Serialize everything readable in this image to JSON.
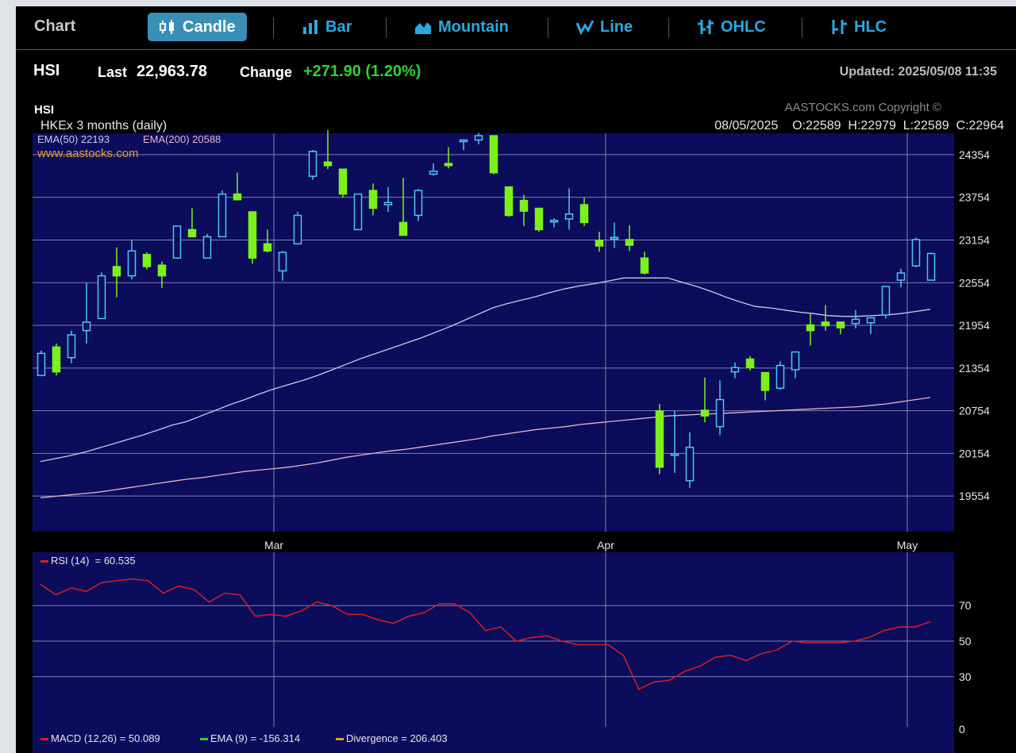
{
  "toolbar": {
    "label": "Chart",
    "buttons": [
      {
        "label": "Candle",
        "icon": "candle-icon",
        "active": true
      },
      {
        "label": "Bar",
        "icon": "bar-icon",
        "active": false
      },
      {
        "label": "Mountain",
        "icon": "mountain-icon",
        "active": false
      },
      {
        "label": "Line",
        "icon": "line-icon",
        "active": false
      },
      {
        "label": "OHLC",
        "icon": "ohlc-icon",
        "active": false
      },
      {
        "label": "HLC",
        "icon": "hlc-icon",
        "active": false
      }
    ]
  },
  "quote": {
    "symbol": "HSI",
    "last_label": "Last",
    "last_value": "22,963.78",
    "change_label": "Change",
    "change_value": "+271.90 (1.20%)",
    "updated": "Updated: 2025/05/08 11:35"
  },
  "colors": {
    "plot_bg": "#0c0c5c",
    "up_candle": "#4fc3f7",
    "down_candle": "#7cf01a",
    "ema50": "#c9c9ec",
    "ema200": "#e2b4c8",
    "rsi": "#d81e1e",
    "change": "#2fd12f"
  },
  "chart_header": {
    "title": "HSI",
    "subtitle": "HKEx  3 months (daily)",
    "copyright": "AASTOCKS.com Copyright ©",
    "ohlc_readout": "08/05/2025    O:22589  H:22979  L:22589  C:22964",
    "ema50_label": "EMA(50) 22193",
    "ema200_label": "EMA(200) 20588",
    "website": "www.aastocks.com"
  },
  "chart_data": [
    {
      "type": "candlestick",
      "title": "HSI",
      "ylim": [
        19054,
        24654
      ],
      "yticks": [
        19554,
        20154,
        20754,
        21354,
        21954,
        22554,
        23154,
        23754,
        24354
      ],
      "xticks": [
        {
          "label": "Mar",
          "index": 15
        },
        {
          "label": "Apr",
          "index": 37
        },
        {
          "label": "May",
          "index": 57
        }
      ],
      "last_index": 60,
      "candles": [
        {
          "o": 21250,
          "h": 21600,
          "l": 21250,
          "c": 21560
        },
        {
          "o": 21650,
          "h": 21700,
          "l": 21250,
          "c": 21300
        },
        {
          "o": 21500,
          "h": 21880,
          "l": 21420,
          "c": 21820
        },
        {
          "o": 21880,
          "h": 22550,
          "l": 21700,
          "c": 22000
        },
        {
          "o": 22050,
          "h": 22700,
          "l": 22050,
          "c": 22650
        },
        {
          "o": 22780,
          "h": 23050,
          "l": 22350,
          "c": 22650
        },
        {
          "o": 22650,
          "h": 23150,
          "l": 22600,
          "c": 23000
        },
        {
          "o": 22950,
          "h": 22980,
          "l": 22740,
          "c": 22780
        },
        {
          "o": 22800,
          "h": 22850,
          "l": 22480,
          "c": 22650
        },
        {
          "o": 22900,
          "h": 23350,
          "l": 22900,
          "c": 23350
        },
        {
          "o": 23300,
          "h": 23600,
          "l": 23200,
          "c": 23200
        },
        {
          "o": 22900,
          "h": 23240,
          "l": 22900,
          "c": 23200
        },
        {
          "o": 23200,
          "h": 23850,
          "l": 23200,
          "c": 23800
        },
        {
          "o": 23800,
          "h": 24100,
          "l": 23720,
          "c": 23720
        },
        {
          "o": 23550,
          "h": 23550,
          "l": 22820,
          "c": 22900
        },
        {
          "o": 23100,
          "h": 23300,
          "l": 22980,
          "c": 23000
        },
        {
          "o": 22720,
          "h": 23000,
          "l": 22580,
          "c": 22980
        },
        {
          "o": 23100,
          "h": 23550,
          "l": 23100,
          "c": 23500
        },
        {
          "o": 24050,
          "h": 24420,
          "l": 24000,
          "c": 24400
        },
        {
          "o": 24250,
          "h": 24700,
          "l": 24150,
          "c": 24200
        },
        {
          "o": 24150,
          "h": 24150,
          "l": 23750,
          "c": 23800
        },
        {
          "o": 23300,
          "h": 23800,
          "l": 23300,
          "c": 23800
        },
        {
          "o": 23850,
          "h": 23950,
          "l": 23500,
          "c": 23600
        },
        {
          "o": 23650,
          "h": 23900,
          "l": 23550,
          "c": 23680
        },
        {
          "o": 23400,
          "h": 24030,
          "l": 23230,
          "c": 23220
        },
        {
          "o": 23500,
          "h": 23870,
          "l": 23420,
          "c": 23850
        },
        {
          "o": 24080,
          "h": 24230,
          "l": 24060,
          "c": 24120
        },
        {
          "o": 24230,
          "h": 24460,
          "l": 24160,
          "c": 24200
        },
        {
          "o": 24550,
          "h": 24560,
          "l": 24420,
          "c": 24560
        },
        {
          "o": 24560,
          "h": 24660,
          "l": 24500,
          "c": 24620
        },
        {
          "o": 24620,
          "h": 24620,
          "l": 24080,
          "c": 24100
        },
        {
          "o": 23900,
          "h": 23900,
          "l": 23480,
          "c": 23500
        },
        {
          "o": 23710,
          "h": 23790,
          "l": 23350,
          "c": 23560
        },
        {
          "o": 23600,
          "h": 23600,
          "l": 23270,
          "c": 23300
        },
        {
          "o": 23410,
          "h": 23460,
          "l": 23330,
          "c": 23430
        },
        {
          "o": 23450,
          "h": 23880,
          "l": 23300,
          "c": 23520
        },
        {
          "o": 23650,
          "h": 23750,
          "l": 23350,
          "c": 23400
        },
        {
          "o": 23150,
          "h": 23270,
          "l": 22990,
          "c": 23070
        },
        {
          "o": 23190,
          "h": 23400,
          "l": 23040,
          "c": 23190
        },
        {
          "o": 23160,
          "h": 23360,
          "l": 23000,
          "c": 23080
        },
        {
          "o": 22900,
          "h": 22990,
          "l": 22670,
          "c": 22690
        },
        {
          "o": 20750,
          "h": 20850,
          "l": 19860,
          "c": 19960
        },
        {
          "o": 20150,
          "h": 20750,
          "l": 19880,
          "c": 20150
        },
        {
          "o": 19770,
          "h": 20450,
          "l": 19670,
          "c": 20240
        },
        {
          "o": 20760,
          "h": 21220,
          "l": 20590,
          "c": 20680
        },
        {
          "o": 20530,
          "h": 21180,
          "l": 20410,
          "c": 20910
        },
        {
          "o": 21300,
          "h": 21430,
          "l": 21210,
          "c": 21360
        },
        {
          "o": 21480,
          "h": 21520,
          "l": 21320,
          "c": 21360
        },
        {
          "o": 21290,
          "h": 21290,
          "l": 20900,
          "c": 21040
        },
        {
          "o": 21070,
          "h": 21450,
          "l": 21050,
          "c": 21390
        },
        {
          "o": 21330,
          "h": 21580,
          "l": 21210,
          "c": 21580
        },
        {
          "o": 21960,
          "h": 22120,
          "l": 21670,
          "c": 21880
        },
        {
          "o": 22000,
          "h": 22240,
          "l": 21880,
          "c": 21950
        },
        {
          "o": 22000,
          "h": 22000,
          "l": 21830,
          "c": 21920
        },
        {
          "o": 21980,
          "h": 22170,
          "l": 21910,
          "c": 22040
        },
        {
          "o": 21990,
          "h": 22050,
          "l": 21830,
          "c": 22060
        },
        {
          "o": 22100,
          "h": 22200,
          "l": 22050,
          "c": 22500
        },
        {
          "o": 22590,
          "h": 22750,
          "l": 22490,
          "c": 22690
        },
        {
          "o": 22790,
          "h": 23190,
          "l": 22770,
          "c": 23160
        },
        {
          "o": 22589,
          "h": 22979,
          "l": 22589,
          "c": 22964
        }
      ],
      "ema50": [
        20040,
        20080,
        20120,
        20170,
        20230,
        20290,
        20350,
        20410,
        20480,
        20550,
        20600,
        20680,
        20760,
        20840,
        20910,
        20990,
        21060,
        21120,
        21180,
        21250,
        21330,
        21410,
        21490,
        21560,
        21630,
        21700,
        21770,
        21850,
        21930,
        22020,
        22110,
        22200,
        22260,
        22310,
        22360,
        22420,
        22470,
        22510,
        22540,
        22580,
        22620,
        22620,
        22620,
        22620,
        22560,
        22500,
        22430,
        22350,
        22280,
        22220,
        22200,
        22170,
        22140,
        22120,
        22090,
        22080,
        22080,
        22090,
        22100,
        22120,
        22150,
        22180,
        22193
      ],
      "ema200": [
        19530,
        19550,
        19570,
        19590,
        19610,
        19640,
        19670,
        19700,
        19730,
        19760,
        19790,
        19810,
        19840,
        19870,
        19900,
        19920,
        19940,
        19960,
        19990,
        20020,
        20060,
        20100,
        20130,
        20160,
        20190,
        20210,
        20240,
        20270,
        20300,
        20330,
        20360,
        20400,
        20430,
        20460,
        20490,
        20510,
        20530,
        20560,
        20580,
        20600,
        20620,
        20640,
        20660,
        20680,
        20690,
        20700,
        20710,
        20720,
        20730,
        20740,
        20750,
        20760,
        20770,
        20780,
        20790,
        20800,
        20810,
        20830,
        20850,
        20880,
        20910,
        20940,
        20588
      ]
    },
    {
      "type": "line",
      "title": "RSI (14)",
      "label": "RSI (14)  = 60.535",
      "ylim": [
        0,
        100
      ],
      "yticks": [
        30,
        50,
        70
      ],
      "zero_label": "0",
      "values": [
        82,
        76,
        80,
        78,
        83,
        84,
        85,
        84,
        77,
        81,
        79,
        72,
        77,
        76,
        64,
        65,
        64,
        67,
        72,
        70,
        65,
        65,
        62,
        60,
        64,
        66,
        71,
        71,
        66,
        56,
        58,
        50,
        52,
        53,
        50,
        48,
        48,
        48,
        42,
        23,
        27,
        28,
        33,
        36,
        41,
        42,
        39,
        43,
        45,
        50,
        49,
        49,
        49,
        50,
        52,
        56,
        58,
        58,
        61
      ]
    },
    {
      "type": "line",
      "title": "MACD (12,26)",
      "legend": [
        {
          "label": "MACD (12,26) = 50.089",
          "color": "#d81e1e"
        },
        {
          "label": "EMA (9) = -156.314",
          "color": "#2fd12f"
        },
        {
          "label": "Divergence = 206.403",
          "color": "#f0a020"
        }
      ]
    }
  ]
}
